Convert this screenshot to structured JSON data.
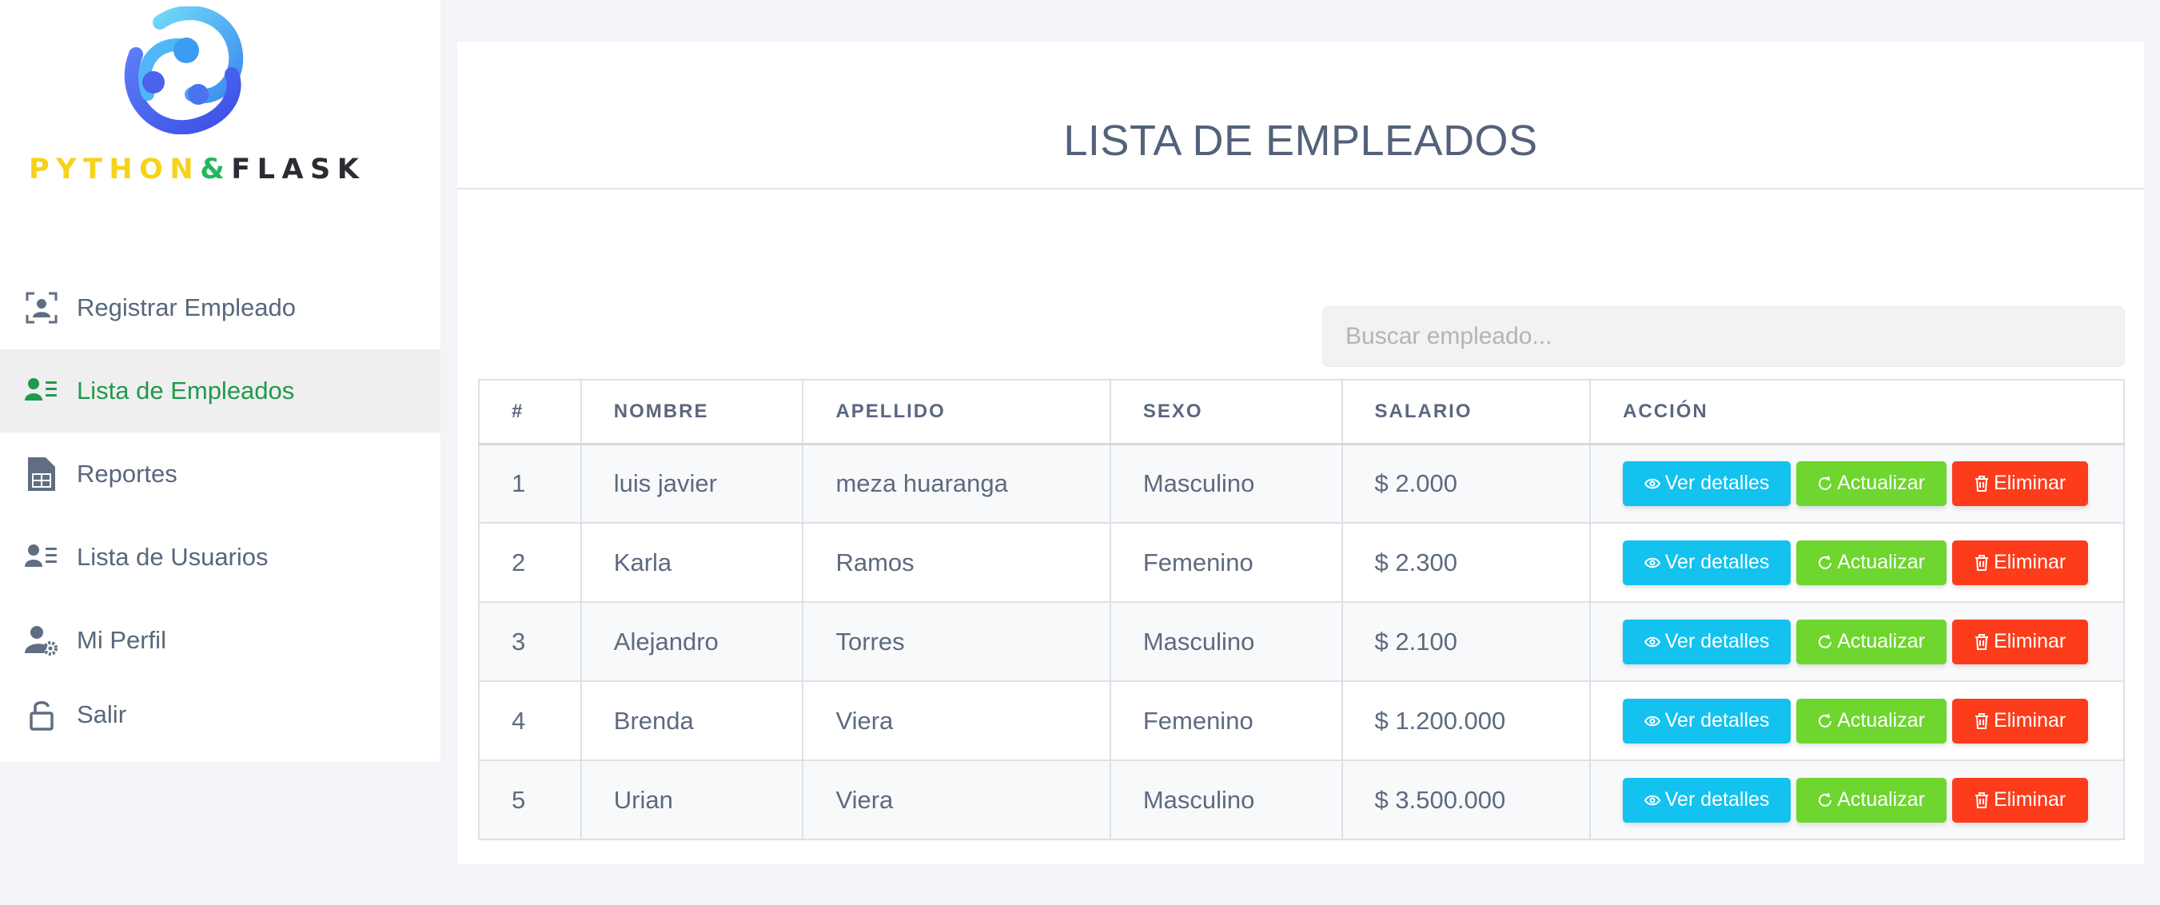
{
  "brand": {
    "logo_parts": [
      "PYTHON",
      "&",
      "FLASK"
    ],
    "colors": {
      "python": "#f6d21c",
      "amp": "#21b75a",
      "flask": "#2b2d33"
    }
  },
  "sidebar": {
    "items": [
      {
        "label": "Registrar Empleado",
        "icon": "register-user-icon",
        "active": false
      },
      {
        "label": "Lista de Empleados",
        "icon": "user-list-icon",
        "active": true
      },
      {
        "label": "Reportes",
        "icon": "report-sheet-icon",
        "active": false
      },
      {
        "label": "Lista de Usuarios",
        "icon": "user-list-icon",
        "active": false
      },
      {
        "label": "Mi Perfil",
        "icon": "user-settings-icon",
        "active": false
      },
      {
        "label": "Salir",
        "icon": "unlock-icon",
        "active": false
      }
    ],
    "active_color": "#1f9a4b"
  },
  "main": {
    "title": "LISTA DE EMPLEADOS",
    "search": {
      "placeholder": "Buscar empleado...",
      "value": ""
    },
    "table": {
      "headers": [
        "#",
        "NOMBRE",
        "APELLIDO",
        "SEXO",
        "SALARIO",
        "ACCIÓN"
      ],
      "rows": [
        {
          "id": "1",
          "nombre": "luis javier",
          "apellido": "meza huaranga",
          "sexo": "Masculino",
          "salario": "$ 2.000"
        },
        {
          "id": "2",
          "nombre": "Karla",
          "apellido": "Ramos",
          "sexo": "Femenino",
          "salario": "$ 2.300"
        },
        {
          "id": "3",
          "nombre": "Alejandro",
          "apellido": "Torres",
          "sexo": "Masculino",
          "salario": "$ 2.100"
        },
        {
          "id": "4",
          "nombre": "Brenda",
          "apellido": "Viera",
          "sexo": "Femenino",
          "salario": "$ 1.200.000"
        },
        {
          "id": "5",
          "nombre": "Urian",
          "apellido": "Viera",
          "sexo": "Masculino",
          "salario": "$ 3.500.000"
        }
      ]
    },
    "actions": {
      "view_label": "Ver detalles",
      "update_label": "Actualizar",
      "delete_label": "Eliminar",
      "colors": {
        "view": "#13c2ef",
        "update": "#6ed62e",
        "delete": "#fc3c1b"
      }
    }
  }
}
